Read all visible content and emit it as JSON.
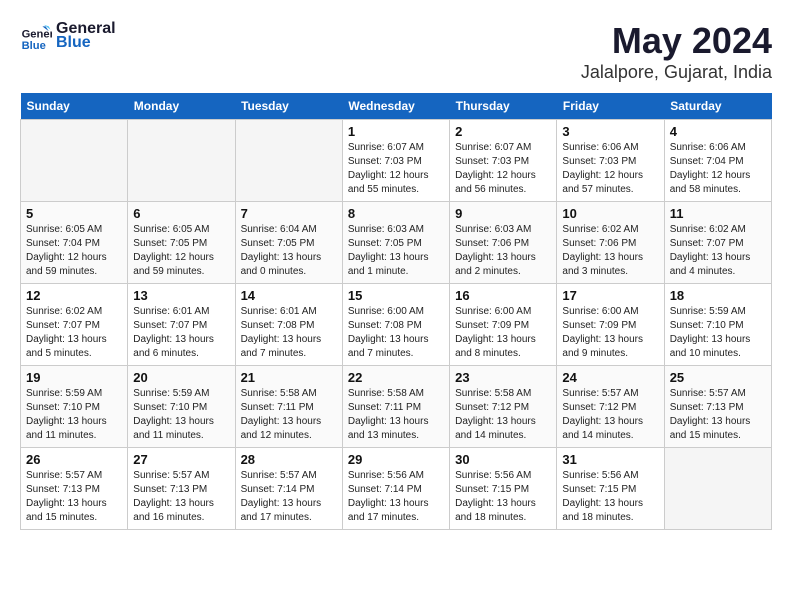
{
  "header": {
    "logo_line1": "General",
    "logo_line2": "Blue",
    "title": "May 2024",
    "subtitle": "Jalalpore, Gujarat, India"
  },
  "weekdays": [
    "Sunday",
    "Monday",
    "Tuesday",
    "Wednesday",
    "Thursday",
    "Friday",
    "Saturday"
  ],
  "weeks": [
    [
      {
        "day": "",
        "info": ""
      },
      {
        "day": "",
        "info": ""
      },
      {
        "day": "",
        "info": ""
      },
      {
        "day": "1",
        "info": "Sunrise: 6:07 AM\nSunset: 7:03 PM\nDaylight: 12 hours\nand 55 minutes."
      },
      {
        "day": "2",
        "info": "Sunrise: 6:07 AM\nSunset: 7:03 PM\nDaylight: 12 hours\nand 56 minutes."
      },
      {
        "day": "3",
        "info": "Sunrise: 6:06 AM\nSunset: 7:03 PM\nDaylight: 12 hours\nand 57 minutes."
      },
      {
        "day": "4",
        "info": "Sunrise: 6:06 AM\nSunset: 7:04 PM\nDaylight: 12 hours\nand 58 minutes."
      }
    ],
    [
      {
        "day": "5",
        "info": "Sunrise: 6:05 AM\nSunset: 7:04 PM\nDaylight: 12 hours\nand 59 minutes."
      },
      {
        "day": "6",
        "info": "Sunrise: 6:05 AM\nSunset: 7:05 PM\nDaylight: 12 hours\nand 59 minutes."
      },
      {
        "day": "7",
        "info": "Sunrise: 6:04 AM\nSunset: 7:05 PM\nDaylight: 13 hours\nand 0 minutes."
      },
      {
        "day": "8",
        "info": "Sunrise: 6:03 AM\nSunset: 7:05 PM\nDaylight: 13 hours\nand 1 minute."
      },
      {
        "day": "9",
        "info": "Sunrise: 6:03 AM\nSunset: 7:06 PM\nDaylight: 13 hours\nand 2 minutes."
      },
      {
        "day": "10",
        "info": "Sunrise: 6:02 AM\nSunset: 7:06 PM\nDaylight: 13 hours\nand 3 minutes."
      },
      {
        "day": "11",
        "info": "Sunrise: 6:02 AM\nSunset: 7:07 PM\nDaylight: 13 hours\nand 4 minutes."
      }
    ],
    [
      {
        "day": "12",
        "info": "Sunrise: 6:02 AM\nSunset: 7:07 PM\nDaylight: 13 hours\nand 5 minutes."
      },
      {
        "day": "13",
        "info": "Sunrise: 6:01 AM\nSunset: 7:07 PM\nDaylight: 13 hours\nand 6 minutes."
      },
      {
        "day": "14",
        "info": "Sunrise: 6:01 AM\nSunset: 7:08 PM\nDaylight: 13 hours\nand 7 minutes."
      },
      {
        "day": "15",
        "info": "Sunrise: 6:00 AM\nSunset: 7:08 PM\nDaylight: 13 hours\nand 7 minutes."
      },
      {
        "day": "16",
        "info": "Sunrise: 6:00 AM\nSunset: 7:09 PM\nDaylight: 13 hours\nand 8 minutes."
      },
      {
        "day": "17",
        "info": "Sunrise: 6:00 AM\nSunset: 7:09 PM\nDaylight: 13 hours\nand 9 minutes."
      },
      {
        "day": "18",
        "info": "Sunrise: 5:59 AM\nSunset: 7:10 PM\nDaylight: 13 hours\nand 10 minutes."
      }
    ],
    [
      {
        "day": "19",
        "info": "Sunrise: 5:59 AM\nSunset: 7:10 PM\nDaylight: 13 hours\nand 11 minutes."
      },
      {
        "day": "20",
        "info": "Sunrise: 5:59 AM\nSunset: 7:10 PM\nDaylight: 13 hours\nand 11 minutes."
      },
      {
        "day": "21",
        "info": "Sunrise: 5:58 AM\nSunset: 7:11 PM\nDaylight: 13 hours\nand 12 minutes."
      },
      {
        "day": "22",
        "info": "Sunrise: 5:58 AM\nSunset: 7:11 PM\nDaylight: 13 hours\nand 13 minutes."
      },
      {
        "day": "23",
        "info": "Sunrise: 5:58 AM\nSunset: 7:12 PM\nDaylight: 13 hours\nand 14 minutes."
      },
      {
        "day": "24",
        "info": "Sunrise: 5:57 AM\nSunset: 7:12 PM\nDaylight: 13 hours\nand 14 minutes."
      },
      {
        "day": "25",
        "info": "Sunrise: 5:57 AM\nSunset: 7:13 PM\nDaylight: 13 hours\nand 15 minutes."
      }
    ],
    [
      {
        "day": "26",
        "info": "Sunrise: 5:57 AM\nSunset: 7:13 PM\nDaylight: 13 hours\nand 15 minutes."
      },
      {
        "day": "27",
        "info": "Sunrise: 5:57 AM\nSunset: 7:13 PM\nDaylight: 13 hours\nand 16 minutes."
      },
      {
        "day": "28",
        "info": "Sunrise: 5:57 AM\nSunset: 7:14 PM\nDaylight: 13 hours\nand 17 minutes."
      },
      {
        "day": "29",
        "info": "Sunrise: 5:56 AM\nSunset: 7:14 PM\nDaylight: 13 hours\nand 17 minutes."
      },
      {
        "day": "30",
        "info": "Sunrise: 5:56 AM\nSunset: 7:15 PM\nDaylight: 13 hours\nand 18 minutes."
      },
      {
        "day": "31",
        "info": "Sunrise: 5:56 AM\nSunset: 7:15 PM\nDaylight: 13 hours\nand 18 minutes."
      },
      {
        "day": "",
        "info": ""
      }
    ]
  ]
}
